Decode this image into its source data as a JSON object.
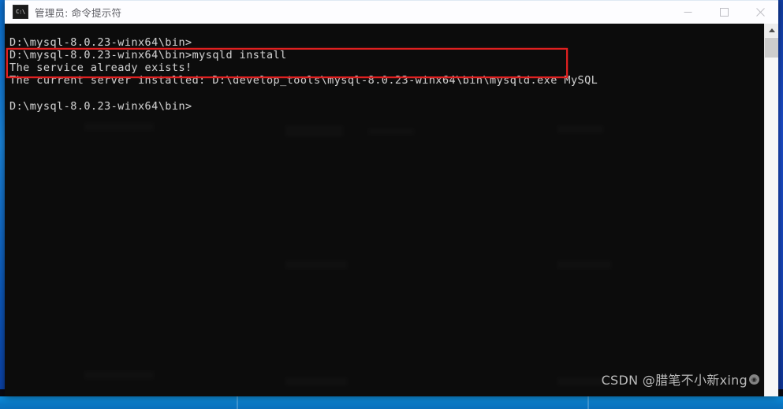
{
  "window": {
    "title": "管理员: 命令提示符",
    "icon_label": "C:\\",
    "controls": {
      "minimize": "−",
      "maximize": "□",
      "close": "✕"
    }
  },
  "console": {
    "lines": [
      "D:\\mysql-8.0.23-winx64\\bin>",
      "D:\\mysql-8.0.23-winx64\\bin>mysqld install",
      "The service already exists!",
      "The current server installed: D:\\develop_tools\\mysql-8.0.23-winx64\\bin\\mysqld.exe MySQL",
      "",
      "D:\\mysql-8.0.23-winx64\\bin>"
    ],
    "text": "D:\\mysql-8.0.23-winx64\\bin>\nD:\\mysql-8.0.23-winx64\\bin>mysqld install\nThe service already exists!\nThe current server installed: D:\\develop_tools\\mysql-8.0.23-winx64\\bin\\mysqld.exe MySQL\n\nD:\\mysql-8.0.23-winx64\\bin>",
    "foreground_color": "#cccccc",
    "background_color": "#0c0c0c"
  },
  "annotation": {
    "highlight_color": "#e02020",
    "covers_lines": [
      "The service already exists!",
      "The current server installed: D:\\develop_tools\\mysql-8.0.23-winx64\\bin\\mysqld.exe MySQL"
    ]
  },
  "scrollbar": {
    "up_arrow": "▲",
    "position": "top"
  },
  "watermark": {
    "text": "CSDN @腊笔不小新xing",
    "badge": "◉"
  },
  "desktop": {
    "background_color": "#0d3ea8",
    "taskbar_color": "#0a79c6"
  }
}
